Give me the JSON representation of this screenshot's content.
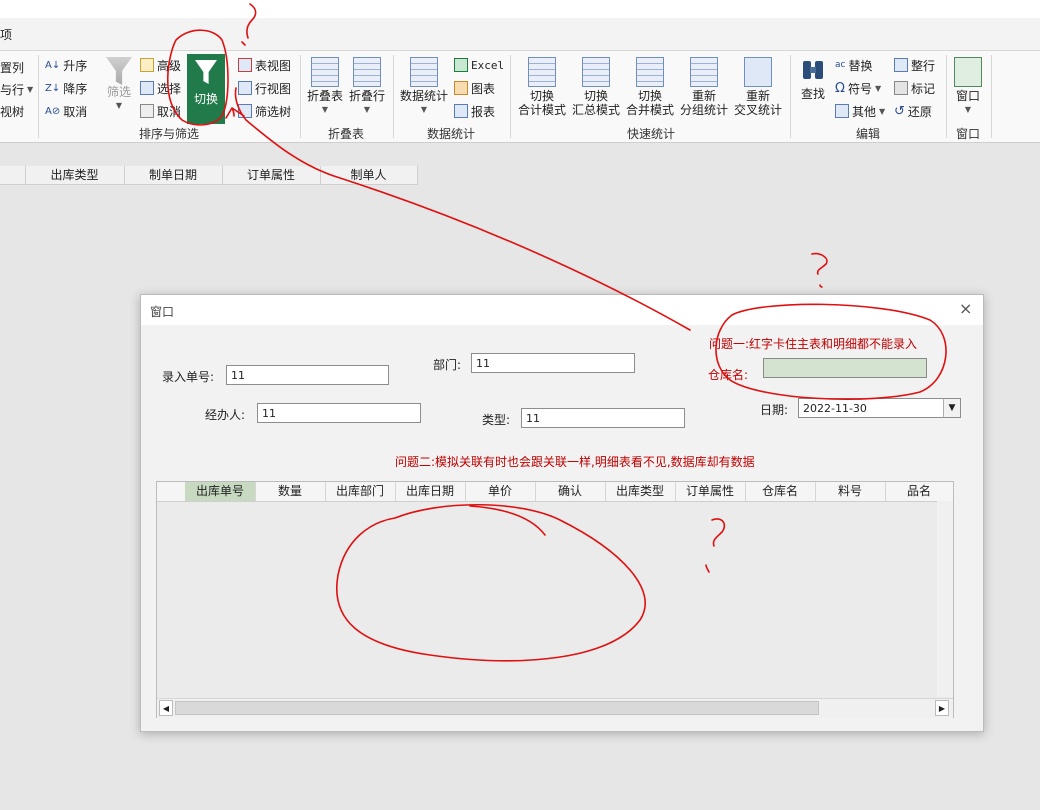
{
  "tabbar": {
    "tab_fragment": "项"
  },
  "ribbon": {
    "left_partial": [
      "置列",
      "与行",
      "视树"
    ],
    "sort": {
      "asc": "升序",
      "desc": "降序",
      "cancel": "取消",
      "filter": "筛选",
      "advanced": "高级",
      "select": "选择",
      "cancel_filter": "取消",
      "switch": "切换",
      "table_view": "表视图",
      "row_view": "行视图",
      "filter_tree": "筛选树",
      "group_label": "排序与筛选"
    },
    "fold": {
      "fold_table": "折叠表",
      "fold_row": "折叠行",
      "group_label": "折叠表"
    },
    "stats": {
      "data_stats": "数据统计",
      "excel": "Excel",
      "chart": "图表",
      "report": "报表",
      "group_label": "数据统计"
    },
    "quick": {
      "btn1_l1": "切换",
      "btn1_l2": "合计模式",
      "btn2_l1": "切换",
      "btn2_l2": "汇总模式",
      "btn3_l1": "切换",
      "btn3_l2": "合并模式",
      "btn4_l1": "重新",
      "btn4_l2": "分组统计",
      "btn5_l1": "重新",
      "btn5_l2": "交叉统计",
      "group_label": "快速统计"
    },
    "edit": {
      "find": "查找",
      "replace": "替换",
      "symbol": "符号",
      "other": "其他",
      "whole_row": "整行",
      "mark": "标记",
      "restore": "还原",
      "group_label": "编辑"
    },
    "window": {
      "window": "窗口",
      "group_label": "窗口"
    }
  },
  "columns": [
    "出库类型",
    "制单日期",
    "订单属性",
    "制单人"
  ],
  "dialog": {
    "title": "窗口",
    "close": "×",
    "entry_label": "录入单号:",
    "entry_value": "11",
    "dept_label": "部门:",
    "dept_value": "11",
    "handler_label": "经办人:",
    "handler_value": "11",
    "type_label": "类型:",
    "type_value": "11",
    "warehouse_label": "仓库名:",
    "warehouse_value": "",
    "date_label": "日期:",
    "date_value": "2022-11-30",
    "issue1": "问题一:红字卡住主表和明细都不能录入",
    "issue2": "问题二:模拟关联有时也会跟关联一样,明细表看不见,数据库却有数据",
    "grid_headers": [
      "出库单号",
      "数量",
      "出库部门",
      "出库日期",
      "单价",
      "确认",
      "出库类型",
      "订单属性",
      "仓库名",
      "料号",
      "品名"
    ]
  },
  "colors": {
    "switch_bg": "#207a4a",
    "annotation_red": "#e01010",
    "issue_text": "#c00000",
    "warehouse_bg": "#d4e2d0"
  }
}
